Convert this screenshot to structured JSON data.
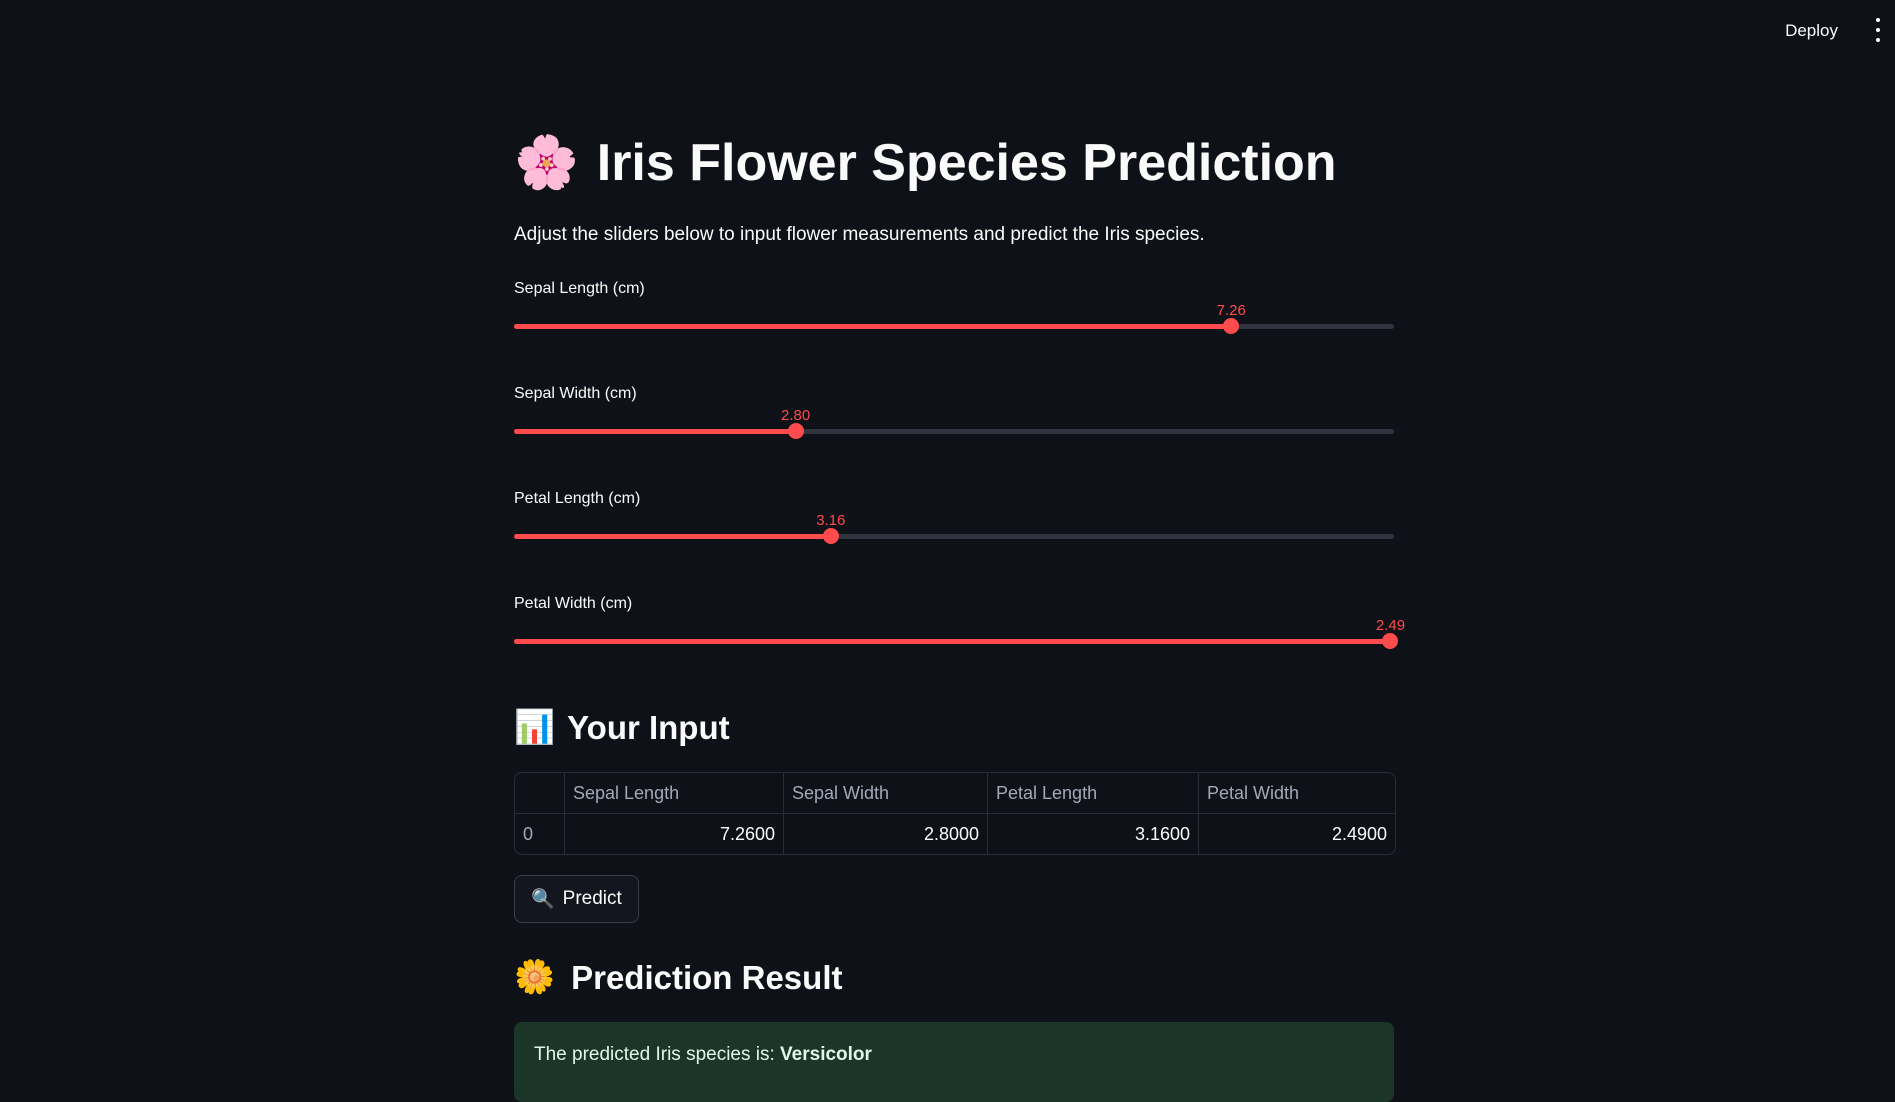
{
  "header": {
    "deploy_label": "Deploy"
  },
  "page": {
    "title_emoji": "🌸",
    "title": "Iris Flower Species Prediction",
    "subtitle": "Adjust the sliders below to input flower measurements and predict the Iris species."
  },
  "sliders": [
    {
      "label": "Sepal Length (cm)",
      "value": "7.26",
      "fraction": 0.815
    },
    {
      "label": "Sepal Width (cm)",
      "value": "2.80",
      "fraction": 0.32
    },
    {
      "label": "Petal Length (cm)",
      "value": "3.16",
      "fraction": 0.36
    },
    {
      "label": "Petal Width (cm)",
      "value": "2.49",
      "fraction": 0.996
    }
  ],
  "input_section": {
    "emoji": "📊",
    "heading": "Your Input"
  },
  "table": {
    "columns": [
      "",
      "Sepal Length",
      "Sepal Width",
      "Petal Length",
      "Petal Width"
    ],
    "rows": [
      [
        "0",
        "7.2600",
        "2.8000",
        "3.1600",
        "2.4900"
      ]
    ]
  },
  "predict_button": {
    "icon": "🔍",
    "label": "Predict"
  },
  "result_section": {
    "emoji": "🌼",
    "heading": "Prediction Result",
    "text_prefix": "The predicted Iris species is: ",
    "species": "Versicolor"
  },
  "colors": {
    "background": "#0e1117",
    "accent": "#ff4b4b",
    "success_bg": "#1b3628"
  }
}
